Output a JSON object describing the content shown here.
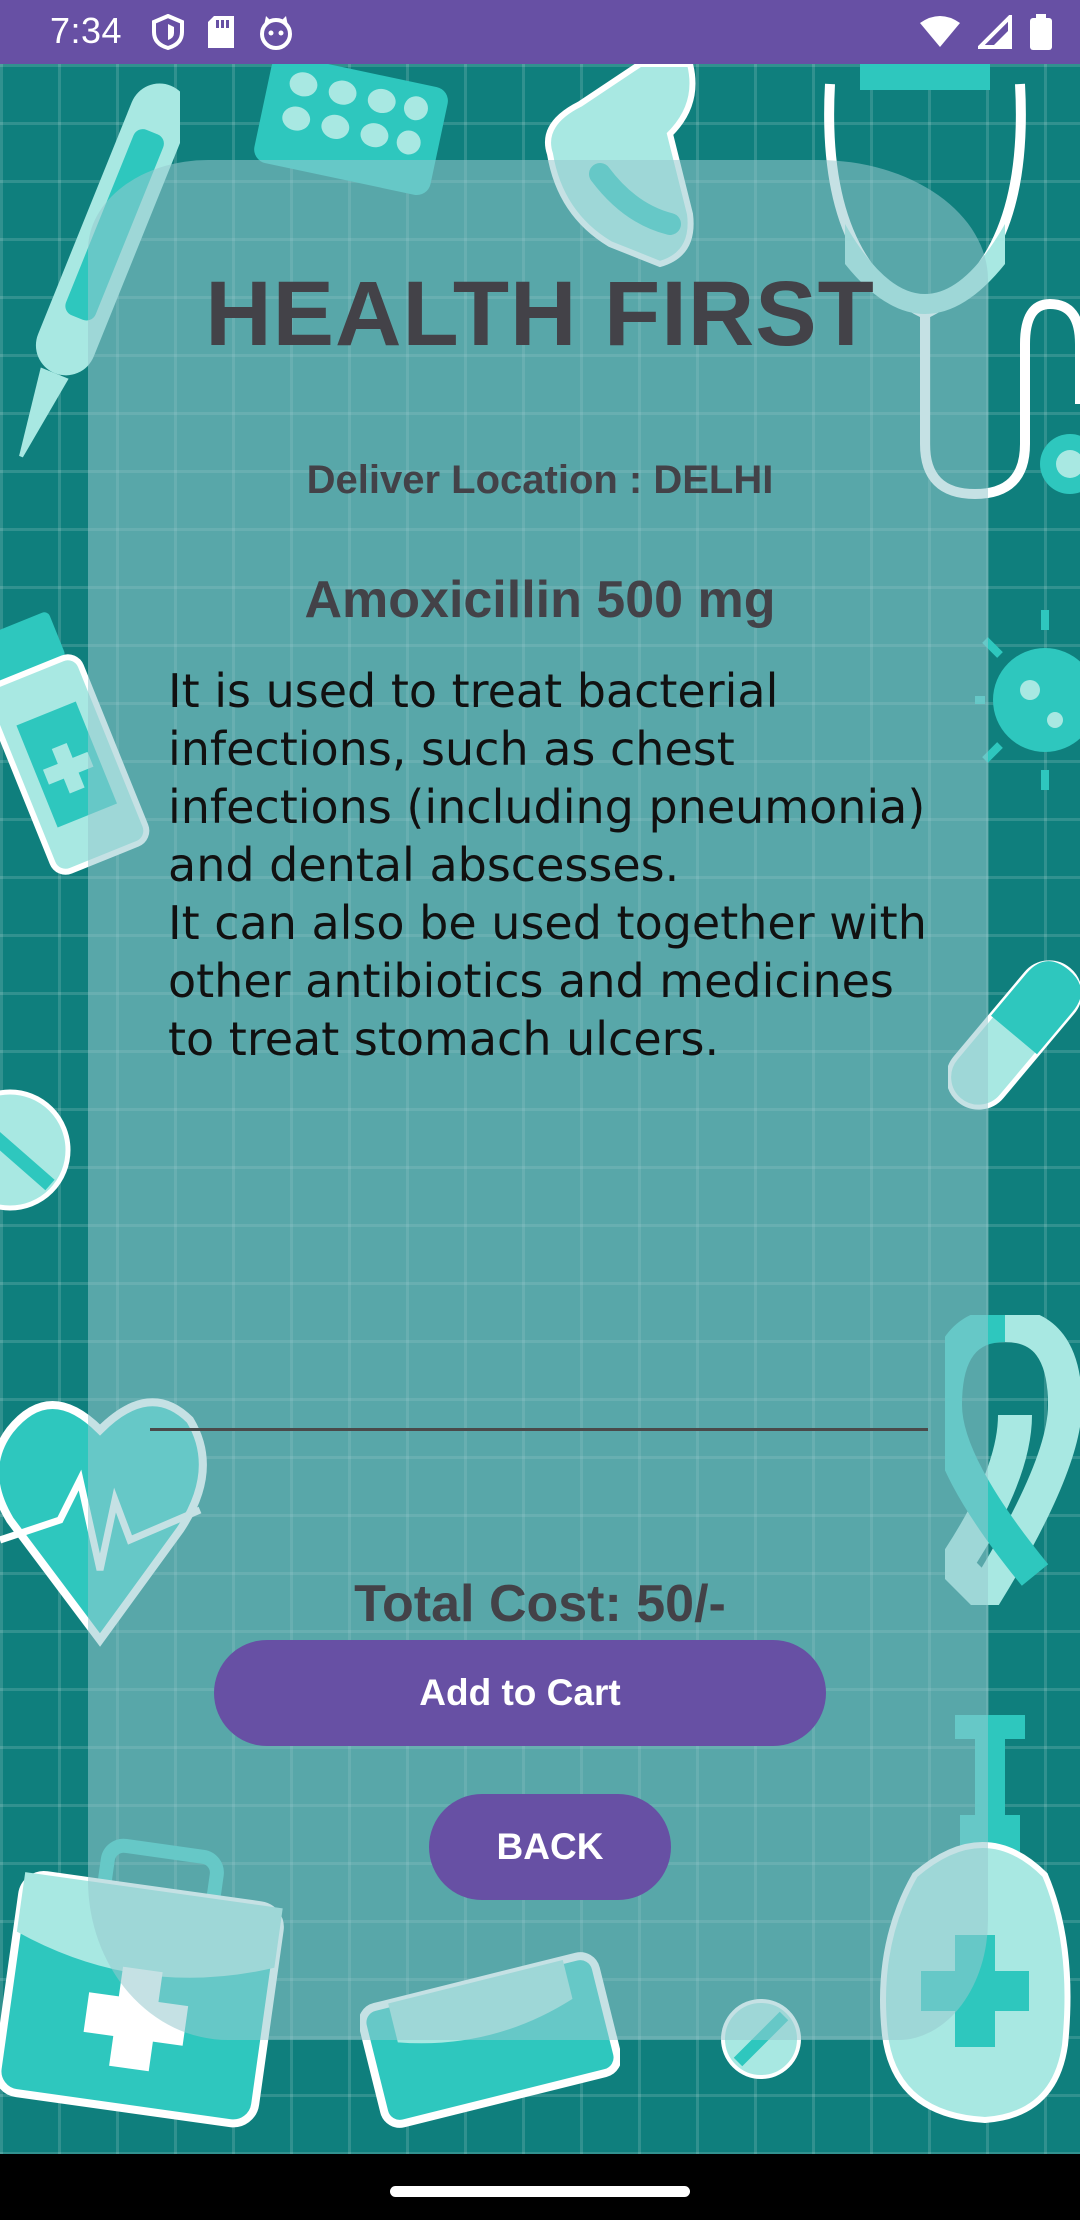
{
  "status_bar": {
    "time": "7:34",
    "left_icons": [
      "shield-icon",
      "sd-card-icon",
      "cat-icon"
    ],
    "right_icons": [
      "wifi-icon",
      "signal-icon",
      "battery-icon"
    ],
    "color": "#6750a4"
  },
  "header": {
    "title": "HEALTH FIRST"
  },
  "location": {
    "text": "Deliver Location : DELHI"
  },
  "medicine": {
    "name": "Amoxicillin 500 mg",
    "description": "It is used to treat bacterial\ninfections, such as chest\ninfections (including pneumonia)\nand dental abscesses.\nIt can also be used together with\nother antibiotics and medicines\nto treat stomach ulcers."
  },
  "total": {
    "text": "Total Cost: 50/-"
  },
  "actions": {
    "add_to_cart": "Add to Cart",
    "back": "BACK"
  },
  "colors": {
    "background": "#0f7f7d",
    "accent": "#6750a4",
    "illustration": "#2ec7be",
    "text": "#434248"
  },
  "decorations": [
    "thermometer-icon",
    "pill-blister-icon",
    "glove-icon",
    "stethoscope-icon",
    "medicine-bottle-icon",
    "virus-icon",
    "capsule-icon",
    "pill-icon",
    "heart-pulse-icon",
    "awareness-ribbon-icon",
    "first-aid-kit-icon",
    "face-mask-icon",
    "sanitizer-bottle-icon"
  ]
}
